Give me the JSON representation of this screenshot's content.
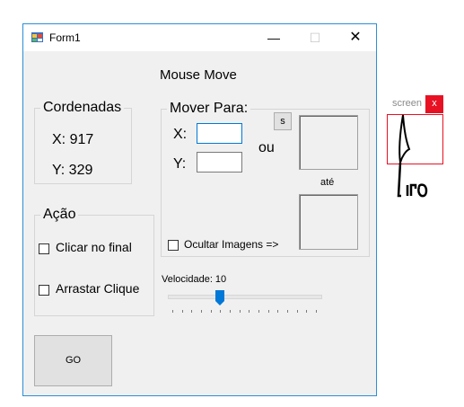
{
  "window": {
    "title": "Form1",
    "minimize_glyph": "—",
    "maximize_glyph": "☐",
    "close_glyph": "✕"
  },
  "heading": "Mouse Move",
  "coordinates": {
    "legend": "Cordenadas",
    "x_label": "X: 917",
    "y_label": "Y: 329"
  },
  "action": {
    "legend": "Ação",
    "click_at_end": "Clicar no final",
    "drag_click": "Arrastar Clique"
  },
  "move_to": {
    "legend": "Mover Para:",
    "x_label": "X:",
    "y_label": "Y:",
    "x_value": "",
    "y_value": "",
    "or_label": "ou",
    "s_button": "s",
    "until_label": "até",
    "hide_images": "Ocultar Imagens =>"
  },
  "speed": {
    "label": "Velocidade: 10",
    "value": 10,
    "min": 0,
    "max": 30
  },
  "go_button": "GO",
  "screen_widget": {
    "label": "screen",
    "close": "x",
    "accent": "#e81123"
  },
  "colors": {
    "window_border": "#2b8fd8",
    "form_bg": "#f0f0f0",
    "focus_border": "#0078d7",
    "thumb": "#0078d7"
  }
}
